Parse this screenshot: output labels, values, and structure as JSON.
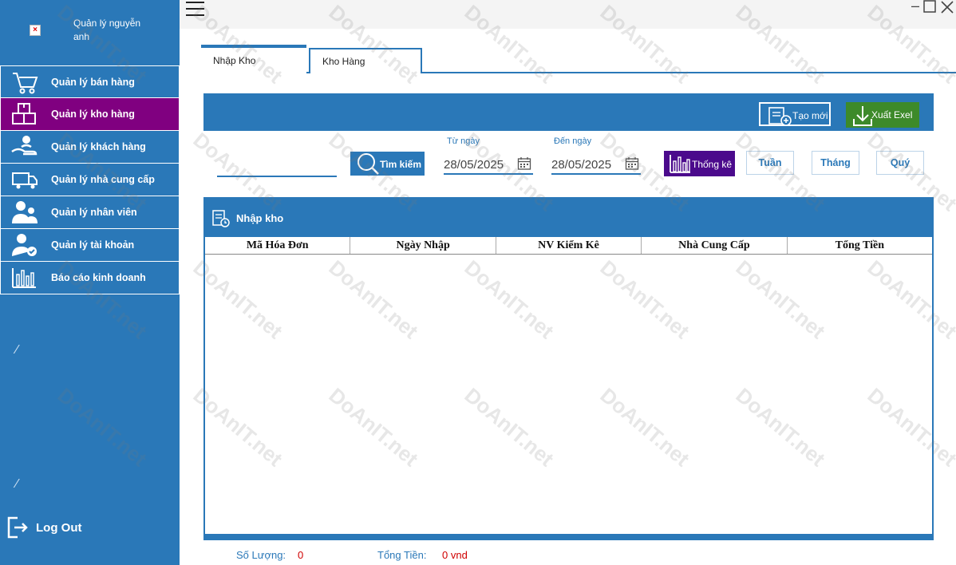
{
  "user": {
    "name": "Quản lý nguyễn anh"
  },
  "sidebar": {
    "items": [
      {
        "label": "Quản lý bán hàng",
        "icon": "cart-icon"
      },
      {
        "label": "Quản lý kho hàng",
        "icon": "warehouse-boxes-icon",
        "active": true
      },
      {
        "label": "Quản lý khách hàng",
        "icon": "customer-hand-icon"
      },
      {
        "label": "Quản lý nhà cung cấp",
        "icon": "delivery-truck-icon"
      },
      {
        "label": "Quản lý nhân viên",
        "icon": "employees-icon"
      },
      {
        "label": "Quản lý tài khoản",
        "icon": "account-user-check-icon"
      },
      {
        "label": "Báo cáo kinh doanh",
        "icon": "bar-chart-icon"
      }
    ],
    "logout": "Log Out"
  },
  "tabs": [
    {
      "label": "Nhập Kho",
      "active": true
    },
    {
      "label": "Kho Hàng",
      "active": false
    }
  ],
  "toolbar": {
    "create": "Tạo mới",
    "export": "Xuất Exel"
  },
  "filters": {
    "search_value": "",
    "search_button": "Tìm kiếm",
    "from_label": "Từ ngày",
    "from_date": "28/05/2025",
    "to_label": "Đến ngày",
    "to_date": "28/05/2025",
    "stats_button": "Thống kê",
    "periods": [
      "Tuần",
      "Tháng",
      "Quý"
    ]
  },
  "grid": {
    "title": "Nhập kho",
    "columns": [
      "Mã Hóa Đơn",
      "Ngày Nhập",
      "NV Kiểm Kê",
      "Nhà Cung Cấp",
      "Tổng Tiền"
    ],
    "rows": []
  },
  "footer": {
    "count_label": "Số Lượng:",
    "count_value": "0",
    "total_label": "Tổng Tiền:",
    "total_value": "0 vnd"
  },
  "watermark": "DoAnIT.net",
  "colors": {
    "primary": "#2a78b8",
    "active_nav": "#800080",
    "stats": "#4b0a8c",
    "export": "#3d8a2a",
    "value_red": "#d00000"
  }
}
